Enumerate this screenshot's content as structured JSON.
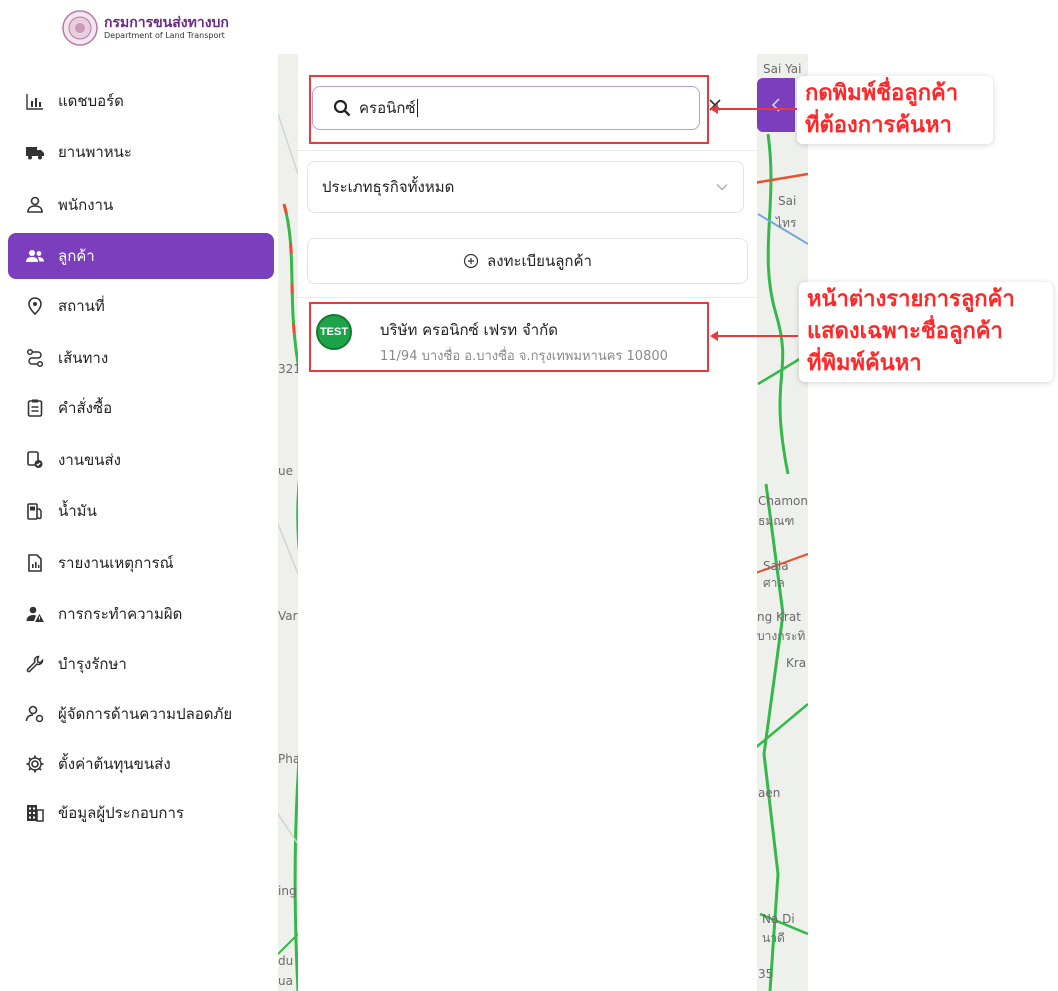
{
  "header": {
    "org_name_th": "กรมการขนส่งทางบก",
    "org_name_en": "Department of Land Transport"
  },
  "sidebar": {
    "items": [
      {
        "label": "แดชบอร์ด",
        "icon": "dashboard-bar-chart-icon",
        "active": false
      },
      {
        "label": "ยานพาหนะ",
        "icon": "truck-icon",
        "active": false
      },
      {
        "label": "พนักงาน",
        "icon": "person-icon",
        "active": false
      },
      {
        "label": "ลูกค้า",
        "icon": "users-icon",
        "active": true
      },
      {
        "label": "สถานที่",
        "icon": "location-pin-icon",
        "active": false
      },
      {
        "label": "เส้นทาง",
        "icon": "route-icon",
        "active": false
      },
      {
        "label": "คำสั่งซื้อ",
        "icon": "clipboard-icon",
        "active": false
      },
      {
        "label": "งานขนส่ง",
        "icon": "delivery-job-icon",
        "active": false
      },
      {
        "label": "น้ำมัน",
        "icon": "fuel-pump-icon",
        "active": false
      },
      {
        "label": "รายงานเหตุการณ์",
        "icon": "report-icon",
        "active": false
      },
      {
        "label": "การกระทำความผิด",
        "icon": "violation-user-icon",
        "active": false
      },
      {
        "label": "บำรุงรักษา",
        "icon": "wrench-icon",
        "active": false
      },
      {
        "label": "ผู้จัดการด้านความปลอดภัย",
        "icon": "safety-manager-icon",
        "active": false
      },
      {
        "label": "ตั้งค่าต้นทุนขนส่ง",
        "icon": "gear-icon",
        "active": false
      },
      {
        "label": "ข้อมูลผู้ประกอบการ",
        "icon": "building-icon",
        "active": false
      }
    ]
  },
  "map": {
    "labels": [
      "Sai Yai",
      "Sai",
      "ไทร",
      "Chamon",
      "ธมณฑ",
      "Sala",
      "ศาล",
      "ng Krat",
      "บางกระทิ",
      "Kra",
      "aen",
      "Na Di",
      "นาดี",
      "35",
      "321",
      "ue",
      "Var",
      "Pha",
      "ing",
      "du",
      "ua"
    ]
  },
  "panel": {
    "search": {
      "value": "ครอนิกซ์"
    },
    "business_type_select": {
      "value": "ประเภทธุรกิจทั้งหมด"
    },
    "register_button_label": "ลงทะเบียนลูกค้า",
    "customers": [
      {
        "avatar_text": "TEST",
        "name": "บริษัท ครอนิกซ์ เฟรท จำกัด",
        "address": "11/94 บางซื่อ อ.บางซื่อ จ.กรุงเทพมหานคร 10800"
      }
    ]
  },
  "annotations": {
    "search_note_line1": "กดพิมพ์ชื่อลูกค้า",
    "search_note_line2": "ที่ต้องการค้นหา",
    "result_note_line1": "หน้าต่างรายการลูกค้า",
    "result_note_line2": "แสดงเฉพาะชื่อลูกค้า",
    "result_note_line3": "ที่พิมพ์ค้นหา",
    "color": "#e83a3a"
  },
  "colors": {
    "accent": "#7b3fbe",
    "avatar_bg": "#1fa34a"
  }
}
